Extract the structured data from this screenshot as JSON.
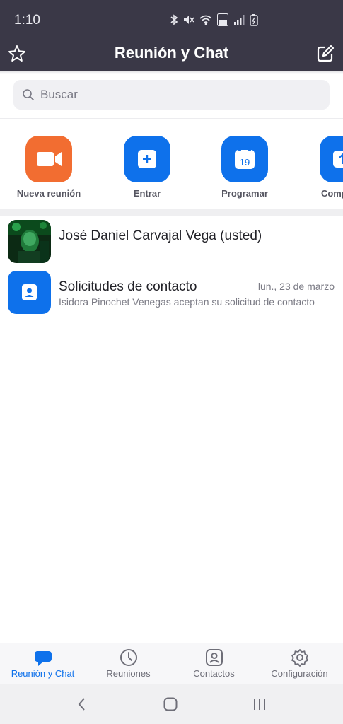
{
  "status_bar": {
    "time": "1:10",
    "icons": [
      "bluetooth-icon",
      "mute-icon",
      "wifi-icon",
      "volte-icon",
      "signal-icon",
      "battery-icon"
    ]
  },
  "header": {
    "title": "Reunión y Chat",
    "left_icon": "star-icon",
    "right_icon": "edit-icon",
    "background_color": "#3a3847"
  },
  "search": {
    "placeholder": "Buscar"
  },
  "actions": [
    {
      "label": "Nueva reunión",
      "icon": "video-camera-icon",
      "color": "#f26d31"
    },
    {
      "label": "Entrar",
      "icon": "plus-icon",
      "color": "#0e71eb"
    },
    {
      "label": "Programar",
      "icon": "calendar-icon",
      "calendar_day": "19",
      "color": "#0e71eb"
    },
    {
      "label": "Compartir",
      "icon": "share-screen-icon",
      "color": "#0e71eb"
    }
  ],
  "list": [
    {
      "title": "José Daniel Carvajal Vega (usted)",
      "avatar": "user-photo"
    },
    {
      "title": "Solicitudes de contacto",
      "date": "lun., 23 de marzo",
      "subtitle": "Isidora Pinochet Venegas aceptan su solicitud de contacto",
      "icon": "contact-request-icon"
    }
  ],
  "bottom_nav": [
    {
      "label": "Reunión y Chat",
      "icon": "chat-bubble-icon",
      "active": true
    },
    {
      "label": "Reuniones",
      "icon": "clock-icon",
      "active": false
    },
    {
      "label": "Contactos",
      "icon": "contact-card-icon",
      "active": false
    },
    {
      "label": "Configuración",
      "icon": "gear-icon",
      "active": false
    }
  ],
  "accent_color": "#0e71eb"
}
